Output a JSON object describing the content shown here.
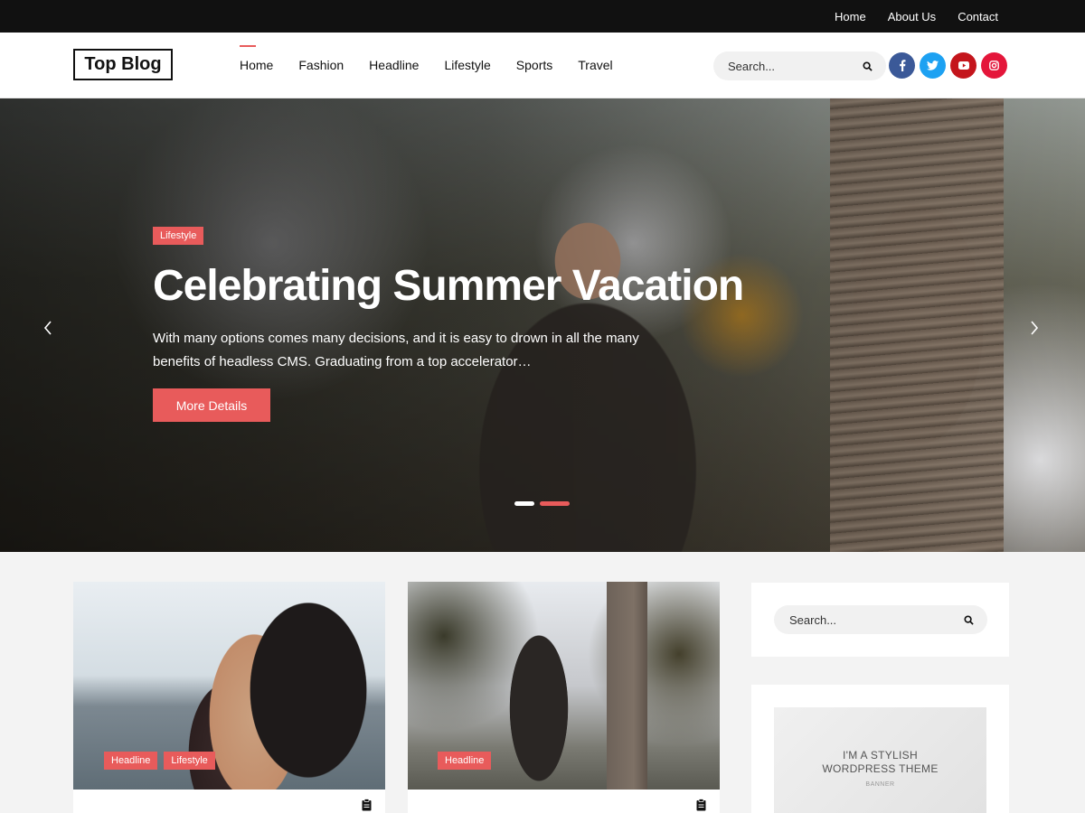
{
  "topbar": {
    "links": [
      "Home",
      "About Us",
      "Contact"
    ]
  },
  "header": {
    "logo": "Top Blog",
    "nav": [
      "Home",
      "Fashion",
      "Headline",
      "Lifestyle",
      "Sports",
      "Travel"
    ],
    "active_nav": "Home",
    "search_placeholder": "Search...",
    "socials": [
      {
        "name": "facebook",
        "glyph": "f",
        "color": "#3b5998"
      },
      {
        "name": "twitter",
        "glyph": "t",
        "color": "#1da1f2"
      },
      {
        "name": "youtube",
        "glyph": "▶",
        "color": "#c4151c"
      },
      {
        "name": "instagram",
        "glyph": "◎",
        "color": "#e4163a"
      }
    ]
  },
  "hero": {
    "category": "Lifestyle",
    "title": "Celebrating Summer Vacation",
    "excerpt": "With many options comes many decisions, and it is easy to drown in all the many benefits of headless CMS. Graduating from a top accelerator…",
    "button": "More Details",
    "slides": 2,
    "active_slide": 2
  },
  "posts": [
    {
      "tags": [
        "Headline",
        "Lifestyle"
      ]
    },
    {
      "tags": [
        "Headline"
      ]
    }
  ],
  "sidebar": {
    "search_placeholder": "Search...",
    "banner": {
      "line1": "I'M A STYLISH",
      "line2": "WORDPRESS THEME",
      "small": "BANNER"
    }
  },
  "colors": {
    "accent": "#e85b5b",
    "topbar": "#111111"
  }
}
